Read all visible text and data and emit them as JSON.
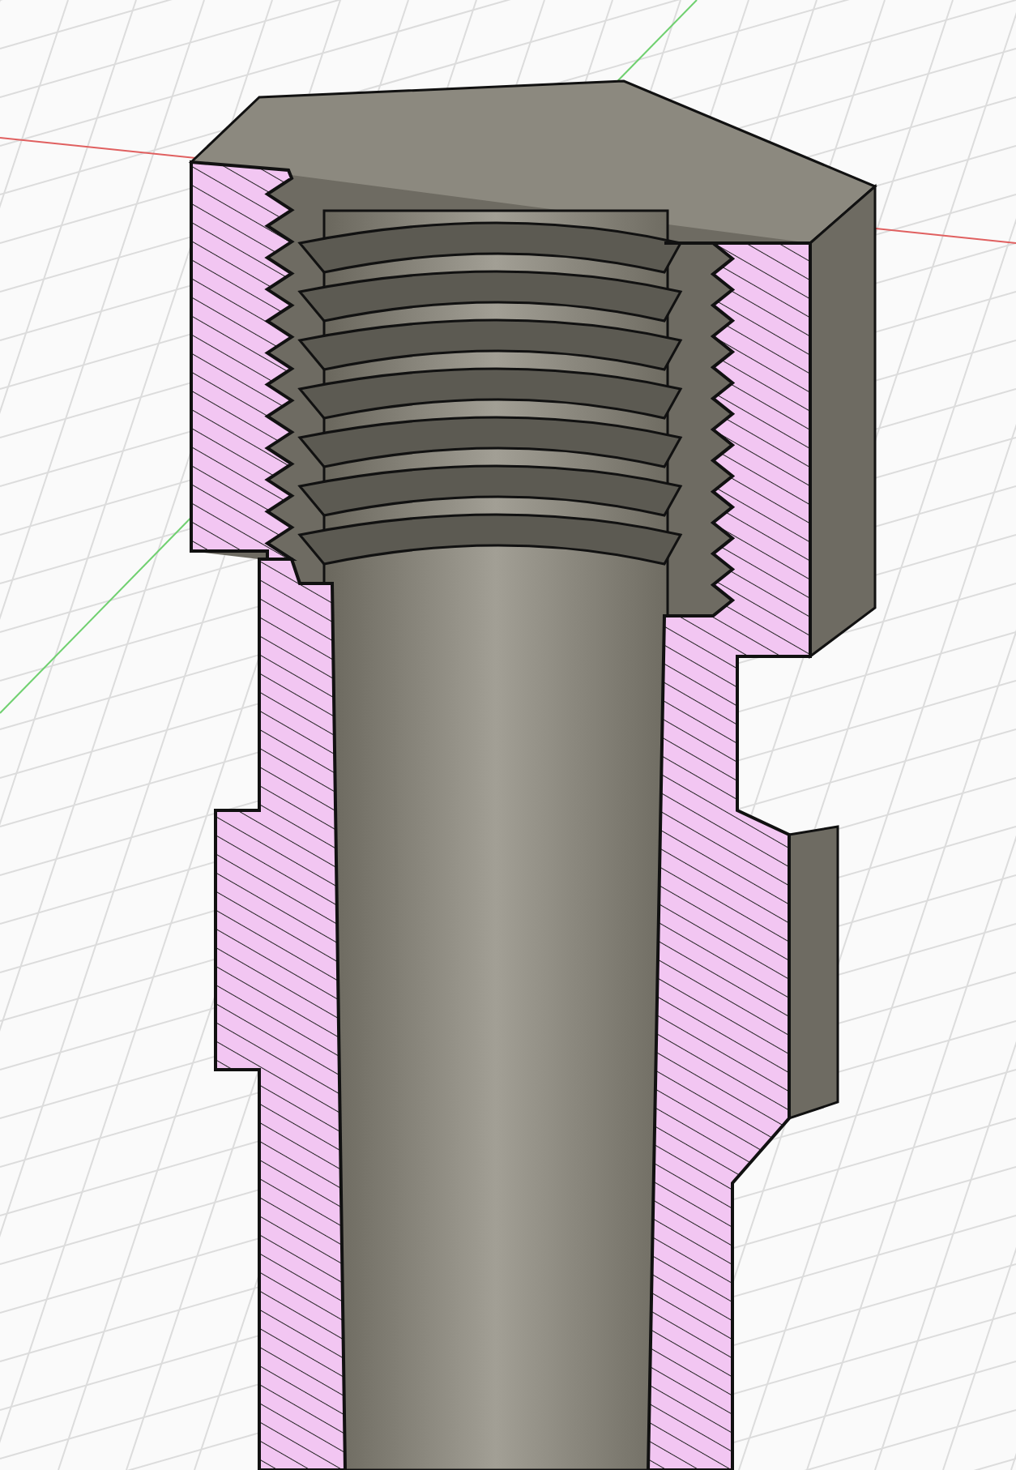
{
  "viewport": {
    "kind": "section-view",
    "grid": true
  }
}
